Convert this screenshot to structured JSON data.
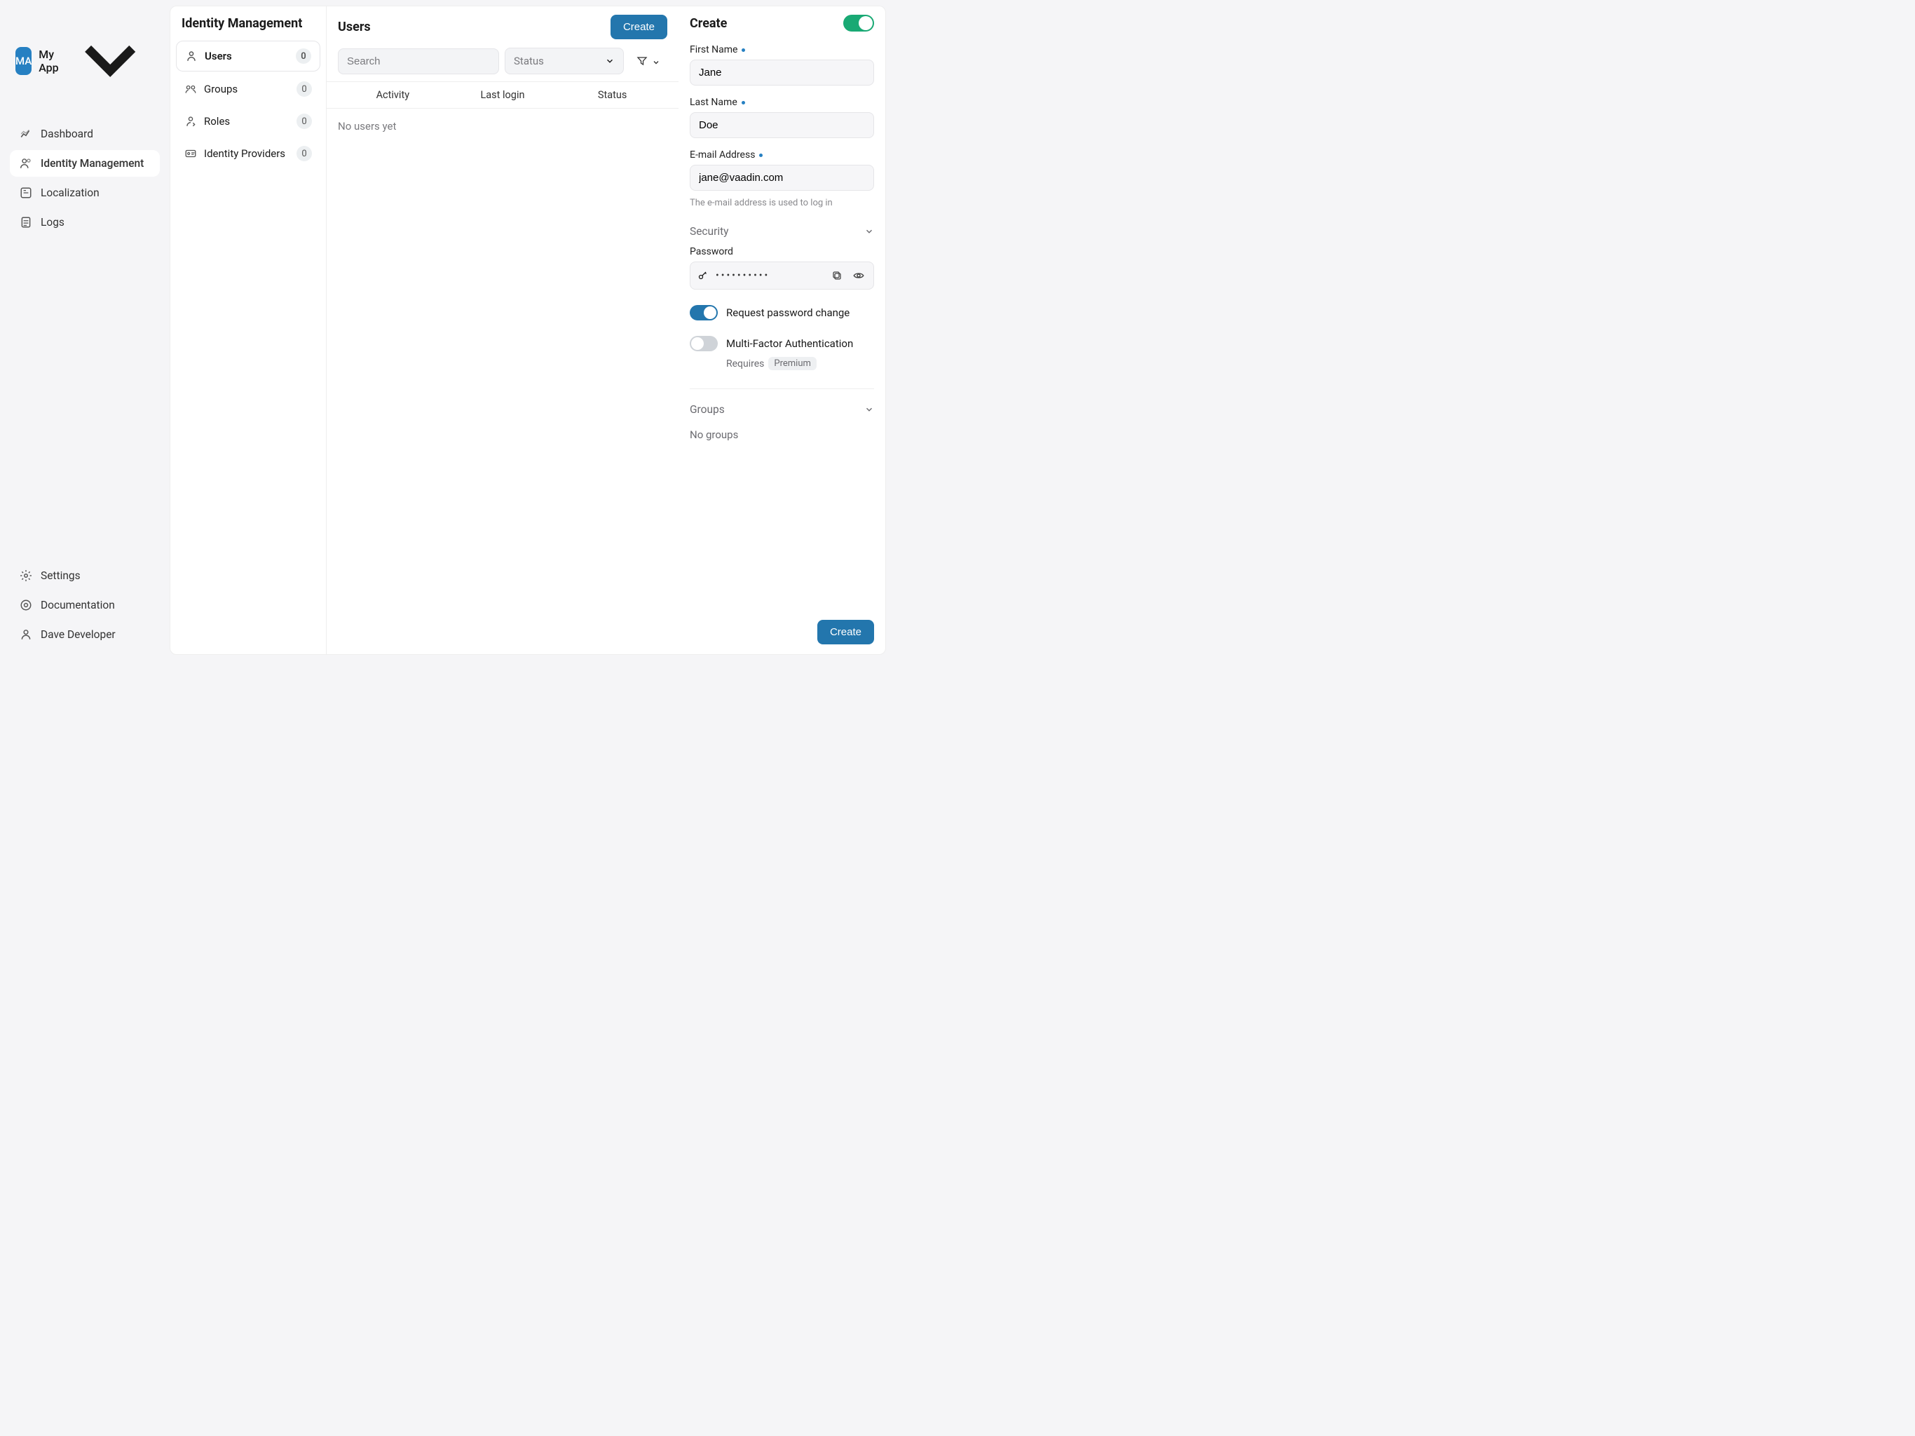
{
  "app": {
    "initials": "MA",
    "name": "My App"
  },
  "sidebar": {
    "items": [
      {
        "label": "Dashboard"
      },
      {
        "label": "Identity Management"
      },
      {
        "label": "Localization"
      },
      {
        "label": "Logs"
      }
    ],
    "footer": {
      "settings": "Settings",
      "documentation": "Documentation",
      "user": "Dave Developer"
    }
  },
  "subnav": {
    "title": "Identity Management",
    "items": [
      {
        "label": "Users",
        "count": "0"
      },
      {
        "label": "Groups",
        "count": "0"
      },
      {
        "label": "Roles",
        "count": "0"
      },
      {
        "label": "Identity Providers",
        "count": "0"
      }
    ]
  },
  "main": {
    "title": "Users",
    "create_btn": "Create",
    "search_placeholder": "Search",
    "status_placeholder": "Status",
    "columns": {
      "activity": "Activity",
      "last_login": "Last login",
      "status": "Status"
    },
    "empty": "No users yet"
  },
  "form": {
    "title": "Create",
    "first_name": {
      "label": "First Name",
      "value": "Jane"
    },
    "last_name": {
      "label": "Last Name",
      "value": "Doe"
    },
    "email": {
      "label": "E-mail Address",
      "value": "jane@vaadin.com",
      "helper": "The e-mail address is used to log in"
    },
    "security": {
      "title": "Security",
      "password_label": "Password",
      "password_mask": "••••••••••"
    },
    "pw_change": "Request password change",
    "mfa": {
      "label": "Multi-Factor Authentication",
      "requires": "Requires",
      "badge": "Premium"
    },
    "groups": {
      "title": "Groups",
      "empty": "No groups"
    },
    "submit": "Create"
  }
}
